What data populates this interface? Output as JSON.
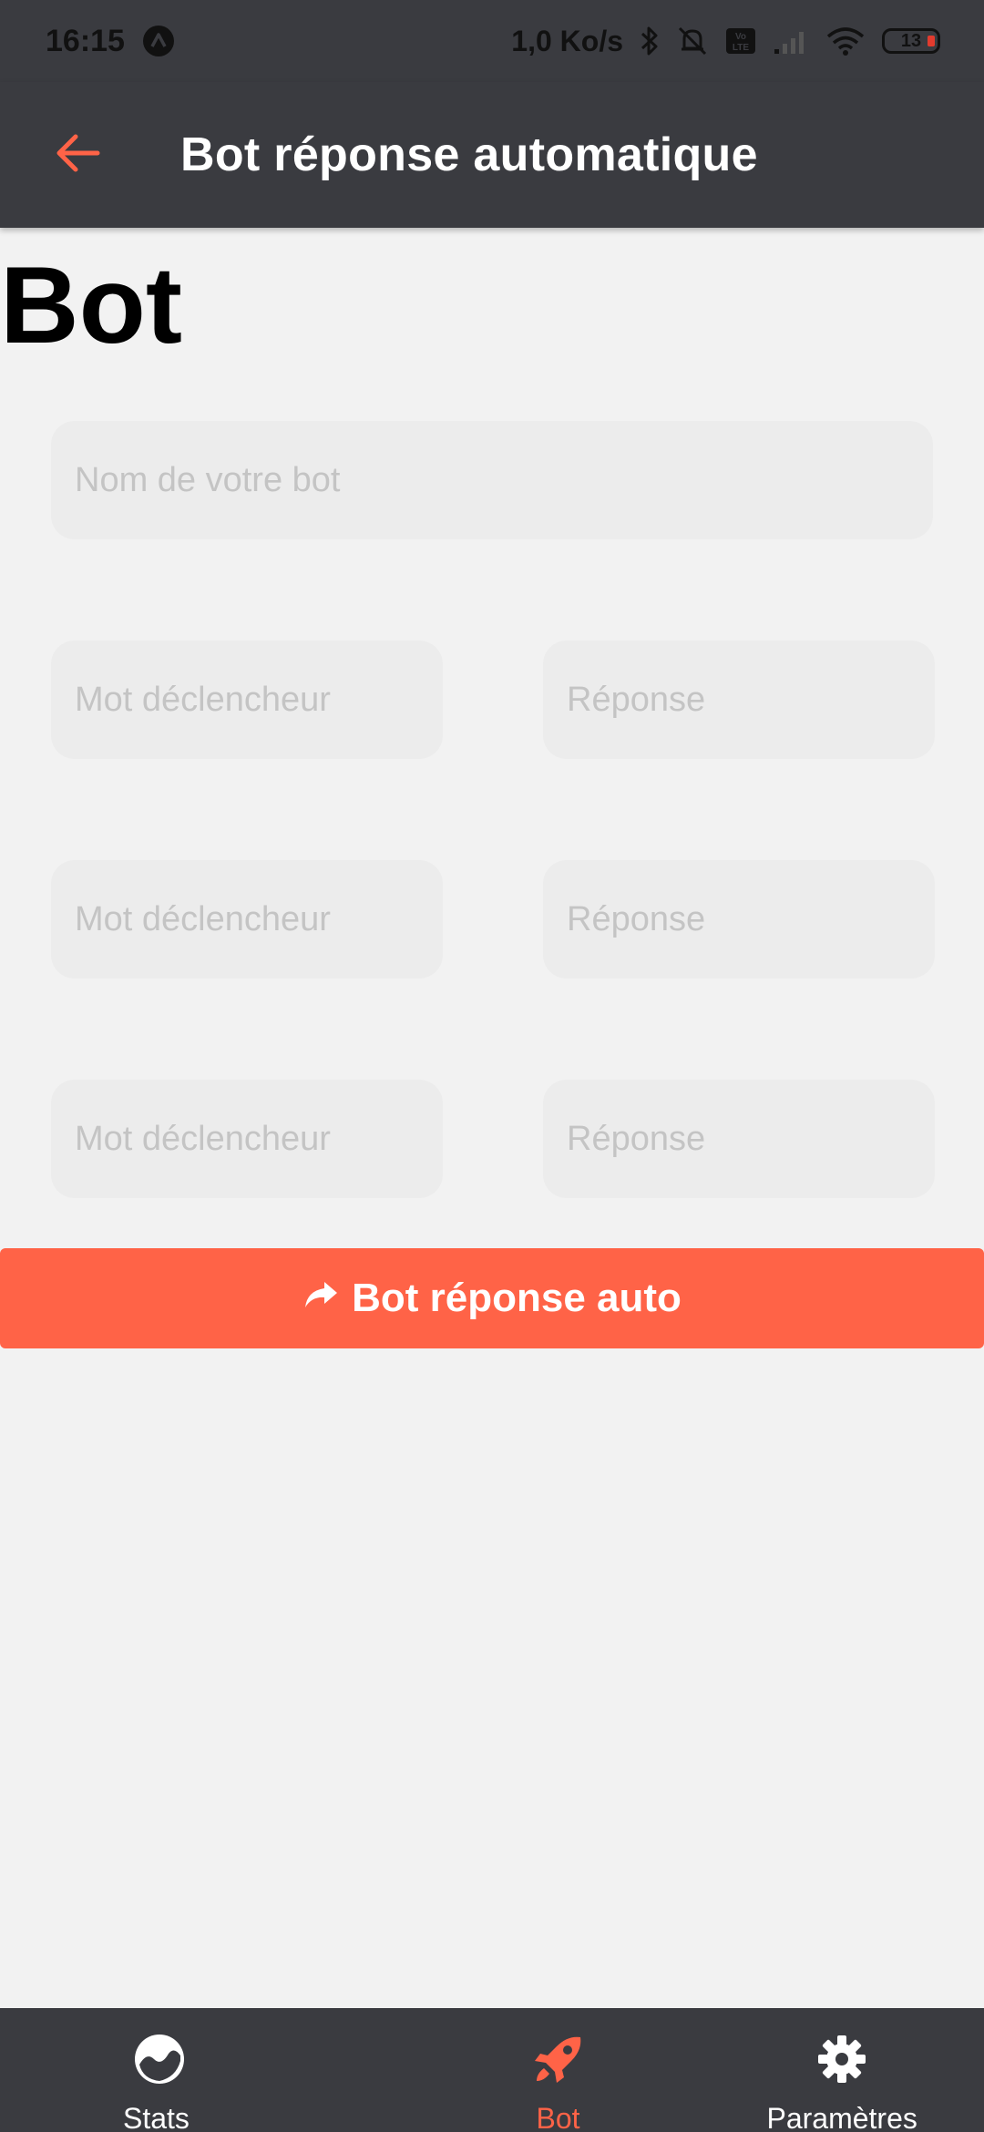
{
  "status_bar": {
    "time": "16:15",
    "network_speed": "1,0 Ko/s",
    "battery": "13",
    "icons": [
      "notification-a-icon",
      "bluetooth-icon",
      "bell-off-icon",
      "volte-icon",
      "signal-icon",
      "wifi-icon",
      "battery-icon"
    ]
  },
  "app_bar": {
    "title": "Bot réponse automatique",
    "back_icon": "arrow-left-icon"
  },
  "page": {
    "heading": "Bot"
  },
  "form": {
    "bot_name_placeholder": "Nom de votre bot",
    "rows": [
      {
        "trigger_placeholder": "Mot déclencheur",
        "reply_placeholder": "Réponse"
      },
      {
        "trigger_placeholder": "Mot déclencheur",
        "reply_placeholder": "Réponse"
      },
      {
        "trigger_placeholder": "Mot déclencheur",
        "reply_placeholder": "Réponse"
      }
    ],
    "submit_label": "Bot réponse auto",
    "submit_icon": "share-arrow-icon"
  },
  "bottom_nav": {
    "items": [
      {
        "label": "Stats",
        "icon": "chart-circle-icon",
        "active": false
      },
      {
        "label": "Bot",
        "icon": "rocket-icon",
        "active": true
      },
      {
        "label": "Paramètres",
        "icon": "gear-icon",
        "active": false
      }
    ]
  },
  "colors": {
    "accent": "#ff6347",
    "bar_background": "#3a3b40",
    "page_background": "#f2f2f2",
    "field_background": "#ececec"
  }
}
